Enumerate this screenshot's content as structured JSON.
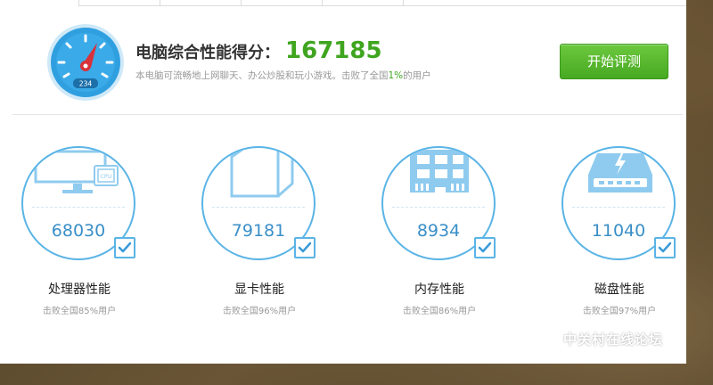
{
  "header": {
    "score_label": "电脑综合性能得分：",
    "score_value": "167185",
    "desc_prefix": "本电脑可流畅地上网聊天、办公炒股和玩小游戏。击败了全国",
    "desc_pct": "1%",
    "desc_suffix": "的用户",
    "gauge_display": "234",
    "start_button": "开始评测"
  },
  "cards": [
    {
      "name": "处理器性能",
      "score": "68030",
      "beat": "击败全国85%用户",
      "icon": "monitor-cpu-icon",
      "chip_label": "CPU"
    },
    {
      "name": "显卡性能",
      "score": "79181",
      "beat": "击败全国96%用户",
      "icon": "graphics-cube-icon"
    },
    {
      "name": "内存性能",
      "score": "8934",
      "beat": "击败全国86%用户",
      "icon": "memory-module-icon"
    },
    {
      "name": "磁盘性能",
      "score": "11040",
      "beat": "击败全国97%用户",
      "icon": "hard-disk-icon"
    }
  ],
  "watermark": {
    "title": "中关村在线论坛",
    "url": "bbs.zol.com.cn"
  },
  "colors": {
    "accent_blue": "#5ab4e6",
    "score_green": "#3fa51f",
    "button_green": "#56b52b"
  }
}
